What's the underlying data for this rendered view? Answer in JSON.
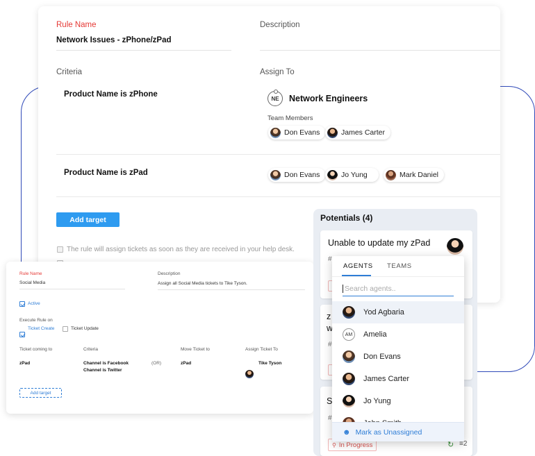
{
  "rule": {
    "name_label": "Rule Name",
    "name_value": "Network Issues - zPhone/zPad",
    "description_label": "Description",
    "criteria_label": "Criteria",
    "assign_to_label": "Assign To",
    "criteria_1": "Product Name is zPhone",
    "criteria_2": "Product Name is zPad",
    "team_initials": "NE",
    "team_name": "Network Engineers",
    "team_members_label": "Team Members",
    "members_1": [
      "Don Evans",
      "James Carter"
    ],
    "members_2": [
      "Don Evans",
      "Jo Yung",
      "Mark Daniel"
    ],
    "add_target_label": "Add target",
    "info_text": "The rule will assign tickets as soon as they are received in your help desk."
  },
  "social": {
    "name_label": "Rule Name",
    "name_value": "Social Media",
    "description_label": "Description",
    "description_value": "Assign all Social Media tickets to Tike Tyson.",
    "active_label": "Active",
    "execute_label": "Execute Rule on",
    "ticket_create": "Ticket Create",
    "ticket_update": "Ticket Update",
    "col_coming": "Ticket coming to",
    "col_criteria": "Criteria",
    "col_move": "Move Ticket to",
    "col_assign": "Assign Ticket To",
    "row_coming": "zPad",
    "row_criteria_1": "Channel is Facebook",
    "row_criteria_2": "Channel is Twitter",
    "row_or": "(OR)",
    "row_move": "zPad",
    "row_assign": "Tike Tyson",
    "add_target_label": "Add target"
  },
  "potentials": {
    "title": "Potentials",
    "count": "(4)",
    "card1_title": "Unable to update my zPad",
    "card_id_prefix": "#",
    "card2_char": "z",
    "card2_char2": "w",
    "card4_char": "S",
    "status_label": "In Progress",
    "reply_count": "2"
  },
  "dropdown": {
    "tab_agents": "AGENTS",
    "tab_teams": "TEAMS",
    "search_placeholder": "Search agents..",
    "agents": [
      {
        "name": "Yod Agbaria"
      },
      {
        "name": "Amelia",
        "initials": "AM"
      },
      {
        "name": "Don Evans"
      },
      {
        "name": "James Carter"
      },
      {
        "name": "Jo Yung"
      },
      {
        "name": "John Smith"
      }
    ],
    "unassign_label": "Mark as Unassigned"
  },
  "colors": {
    "accent": "#2e9bf0",
    "link_blue": "#2e7dd6",
    "required_red": "#e53935",
    "outline_blue": "#2f49b8"
  }
}
